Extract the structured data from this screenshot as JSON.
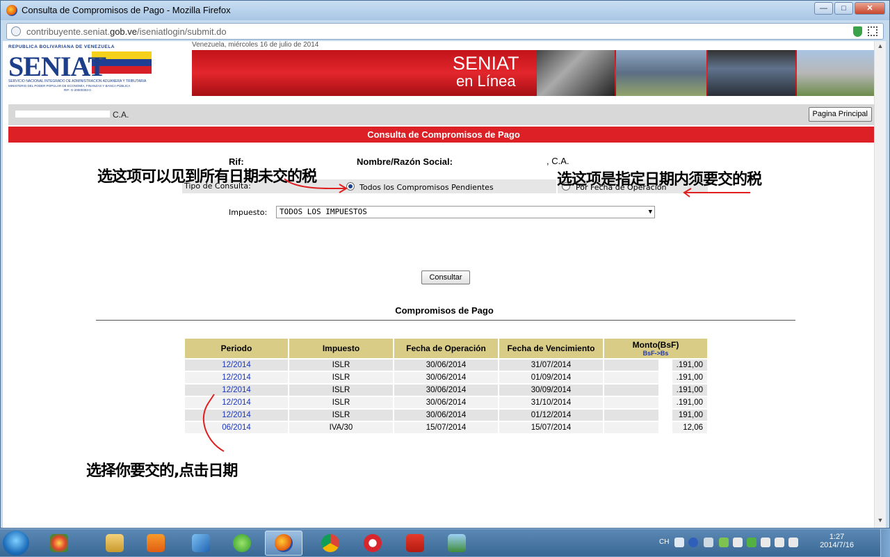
{
  "window": {
    "title": "Consulta de Compromisos de Pago - Mozilla Firefox",
    "url_prefix": "contribuyente.seniat.",
    "url_domain": "gob.ve",
    "url_path": "/iseniatlogin/submit.do"
  },
  "header": {
    "logo_republic": "REPUBLICA BOLIVARIANA DE VENEZUELA",
    "logo_word": "SENIAT",
    "logo_sub1": "SERVICIO NACIONAL INTEGRADO DE ADMINISTRACION ADUANERA Y TRIBUTARIA",
    "logo_sub2": "MINISTERIO DEL PODER POPULAR DE ECONOMÍA, FINANZAS Y BANCA PÚBLICA",
    "logo_rif": "RIF: G-20000303-0",
    "date_line": "Venezuela, miércoles 16 de julio de 2014",
    "banner_line1": "SENIAT",
    "banner_line2": "en Línea"
  },
  "userbar": {
    "company_suffix": "C.A.",
    "home_button": "Pagina Principal"
  },
  "page_title": "Consulta de Compromisos de Pago",
  "form": {
    "rif_label": "Rif:",
    "razon_label": "Nombre/Razón Social:",
    "razon_suffix": ", C.A.",
    "tipo_label": "Tipo de Consulta:",
    "option_all": "Todos los Compromisos Pendientes",
    "option_date": "Por Fecha de Operación",
    "impuesto_label": "Impuesto:",
    "impuesto_value": "TODOS LOS IMPUESTOS",
    "submit_label": "Consultar"
  },
  "results": {
    "title": "Compromisos de Pago",
    "headers": [
      "Periodo",
      "Impuesto",
      "Fecha de Operación",
      "Fecha de Vencimiento",
      "Monto(BsF)"
    ],
    "monto_sub": "BsF->Bs",
    "rows": [
      {
        "periodo": "12/2014",
        "impuesto": "ISLR",
        "fecha_op": "30/06/2014",
        "fecha_venc": "31/07/2014",
        "monto": ".191,00"
      },
      {
        "periodo": "12/2014",
        "impuesto": "ISLR",
        "fecha_op": "30/06/2014",
        "fecha_venc": "01/09/2014",
        "monto": ".191,00"
      },
      {
        "periodo": "12/2014",
        "impuesto": "ISLR",
        "fecha_op": "30/06/2014",
        "fecha_venc": "30/09/2014",
        "monto": ".191,00"
      },
      {
        "periodo": "12/2014",
        "impuesto": "ISLR",
        "fecha_op": "30/06/2014",
        "fecha_venc": "31/10/2014",
        "monto": ".191,00"
      },
      {
        "periodo": "12/2014",
        "impuesto": "ISLR",
        "fecha_op": "30/06/2014",
        "fecha_venc": "01/12/2014",
        "monto": "191,00"
      },
      {
        "periodo": "06/2014",
        "impuesto": "IVA/30",
        "fecha_op": "15/07/2014",
        "fecha_venc": "15/07/2014",
        "monto": "12,06"
      }
    ]
  },
  "annotations": {
    "all_dates": "选这项可以见到所有日期未交的税",
    "by_date": "选这项是指定日期内须要交的税",
    "click_date": "选择你要交的,点击日期"
  },
  "taskbar": {
    "lang": "CH",
    "time": "1:27",
    "date": "2014/7/16"
  },
  "colors": {
    "accent_red": "#dd1f26",
    "table_header": "#d9cc87",
    "link_blue": "#1d36b5",
    "annotation_red": "#e02020"
  }
}
